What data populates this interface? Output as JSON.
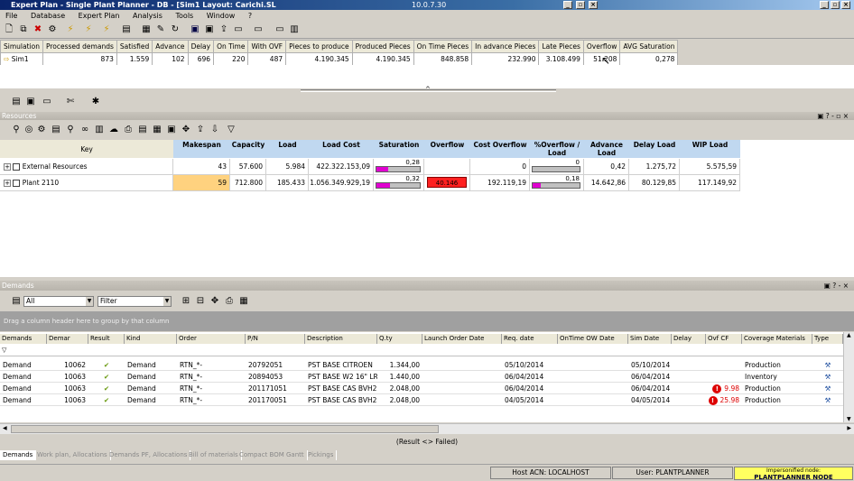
{
  "window": {
    "title": "Expert Plan - Single Plant Planner - DB - [Sim1 Layout: Carichi.SL",
    "version": "10.0.7.30"
  },
  "menu": [
    "File",
    "Database",
    "Expert Plan",
    "Analysis",
    "Tools",
    "Window",
    "?"
  ],
  "simulation": {
    "headers": [
      "Simulation",
      "Processed demands",
      "Satisfied",
      "Advance",
      "Delay",
      "On Time",
      "With OVF",
      "Pieces to produce",
      "Produced Pieces",
      "On Time Pieces",
      "In advance Pieces",
      "Late Pieces",
      "Overflow",
      "AVG Saturation"
    ],
    "row": [
      "Sim1",
      "873",
      "1.559",
      "102",
      "696",
      "220",
      "487",
      "4.190.345",
      "4.190.345",
      "848.858",
      "232.990",
      "3.108.499",
      "51.208",
      "0,278"
    ]
  },
  "resources": {
    "panel_title": "Resources",
    "headers": {
      "key": "Key",
      "makespan": "Makespan",
      "capacity": "Capacity",
      "load": "Load",
      "load_cost": "Load Cost",
      "saturation": "Saturation",
      "overflow": "Overflow",
      "cost_overflow": "Cost Overflow",
      "pct_overflow": "%Overflow / Load",
      "advance_load": "Advance Load",
      "delay_load": "Delay Load",
      "wip_load": "WIP Load"
    },
    "rows": [
      {
        "key": "External Resources",
        "makespan": "43",
        "capacity": "57.600",
        "load": "5.984",
        "load_cost": "422.322.153,09",
        "saturation": "0,28",
        "saturation_value": 0.28,
        "overflow": "",
        "cost_overflow": "0",
        "pct_overflow": "0",
        "pct_value": 0,
        "advance_load": "0,42",
        "delay_load": "1.275,72",
        "wip_load": "5.575,59"
      },
      {
        "key": "Plant 2110",
        "makespan": "59",
        "capacity": "712.800",
        "load": "185.433",
        "load_cost": "1.056.349.929,19",
        "saturation": "0,32",
        "saturation_value": 0.32,
        "overflow": "40.146",
        "cost_overflow": "192.119,19",
        "pct_overflow": "0,18",
        "pct_value": 0.18,
        "advance_load": "14.642,86",
        "delay_load": "80.129,85",
        "wip_load": "117.149,92"
      }
    ]
  },
  "demands": {
    "panel_title": "Demands",
    "filter_all": "All",
    "filter_label": "Filter",
    "group_hint": "Drag a column header here to group by that column",
    "headers": [
      "Demands",
      "Demar",
      "Result",
      "Kind",
      "Order",
      "P/N",
      "Description",
      "Q.ty",
      "Launch Order Date",
      "Req. date",
      "OnTime OW Date",
      "Sim Date",
      "Delay",
      "Ovf CF",
      "Coverage Materials",
      "Type"
    ],
    "rows": [
      {
        "demand": "Demand",
        "demar": "10062",
        "kind": "Demand",
        "order": "RTN_*-",
        "pn": "20792051",
        "desc": "PST BASE CITROEN",
        "qty": "1.344,00",
        "req": "05/10/2014",
        "sim": "05/10/2014",
        "ovf": "",
        "cov": "Production"
      },
      {
        "demand": "Demand",
        "demar": "10063",
        "kind": "Demand",
        "order": "RTN_*-",
        "pn": "20894053",
        "desc": "PST BASE W2 16\" LR",
        "qty": "1.440,00",
        "req": "06/04/2014",
        "sim": "06/04/2014",
        "ovf": "",
        "cov": "Inventory"
      },
      {
        "demand": "Demand",
        "demar": "10063",
        "kind": "Demand",
        "order": "RTN_*-",
        "pn": "201171051",
        "desc": "PST BASE CAS BVH2",
        "qty": "2.048,00",
        "req": "06/04/2014",
        "sim": "06/04/2014",
        "ovf": "9.98",
        "cov": "Production"
      },
      {
        "demand": "Demand",
        "demar": "10063",
        "kind": "Demand",
        "order": "RTN_*-",
        "pn": "201170051",
        "desc": "PST BASE CAS BVH2",
        "qty": "2.048,00",
        "req": "04/05/2014",
        "sim": "04/05/2014",
        "ovf": "25.98",
        "cov": "Production"
      }
    ],
    "footer_legend": "(Result <> Failed)"
  },
  "tabs": [
    "Demands",
    "Work plan, Allocations",
    "Demands PF, Allocations",
    "Bill of materials",
    "Compact BOM Gantt",
    "Pickings"
  ],
  "status": {
    "host": "Host ACN: LOCALHOST",
    "user": "User: PLANTPLANNER",
    "impersonated_label": "Impersonified node:",
    "node": "PLANTPLANNER  NODE"
  },
  "colors": {
    "accent": "#0a246a",
    "overflow_red": "#ff2020",
    "makespan_highlight": "#ffd27f",
    "saturation_fill": "#e000d0",
    "header_blue": "#c0d8f0"
  }
}
